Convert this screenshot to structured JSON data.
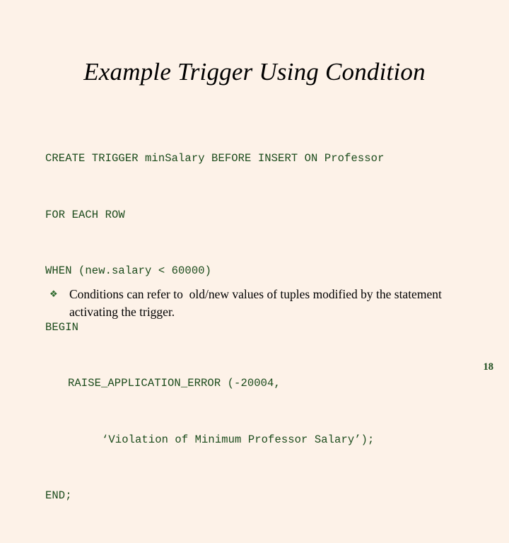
{
  "slide": {
    "background_color": "#FDF2E8",
    "title": "Example Trigger Using Condition",
    "title_color": "#000000",
    "page_number": "18",
    "page_number_color": "#1B4B1B"
  },
  "code": {
    "color": "#1B4B1B",
    "lines": [
      {
        "text": "CREATE TRIGGER minSalary BEFORE INSERT ON Professor",
        "indent": 0
      },
      {
        "text": "FOR EACH ROW",
        "indent": 0
      },
      {
        "text": "WHEN (new.salary < 60000)",
        "indent": 0
      },
      {
        "text": "BEGIN",
        "indent": 0
      },
      {
        "text": "RAISE_APPLICATION_ERROR (-20004,",
        "indent": 1
      },
      {
        "text": "‘Violation of Minimum Professor Salary’);",
        "indent": 2
      },
      {
        "text": "END;",
        "indent": 0
      }
    ]
  },
  "bullets": [
    {
      "marker": "❖",
      "marker_name": "diamond-bullet-icon",
      "marker_color": "#2F6B2F",
      "text": "Conditions can refer to  old/new values of tuples modified by the statement activating the trigger."
    }
  ]
}
